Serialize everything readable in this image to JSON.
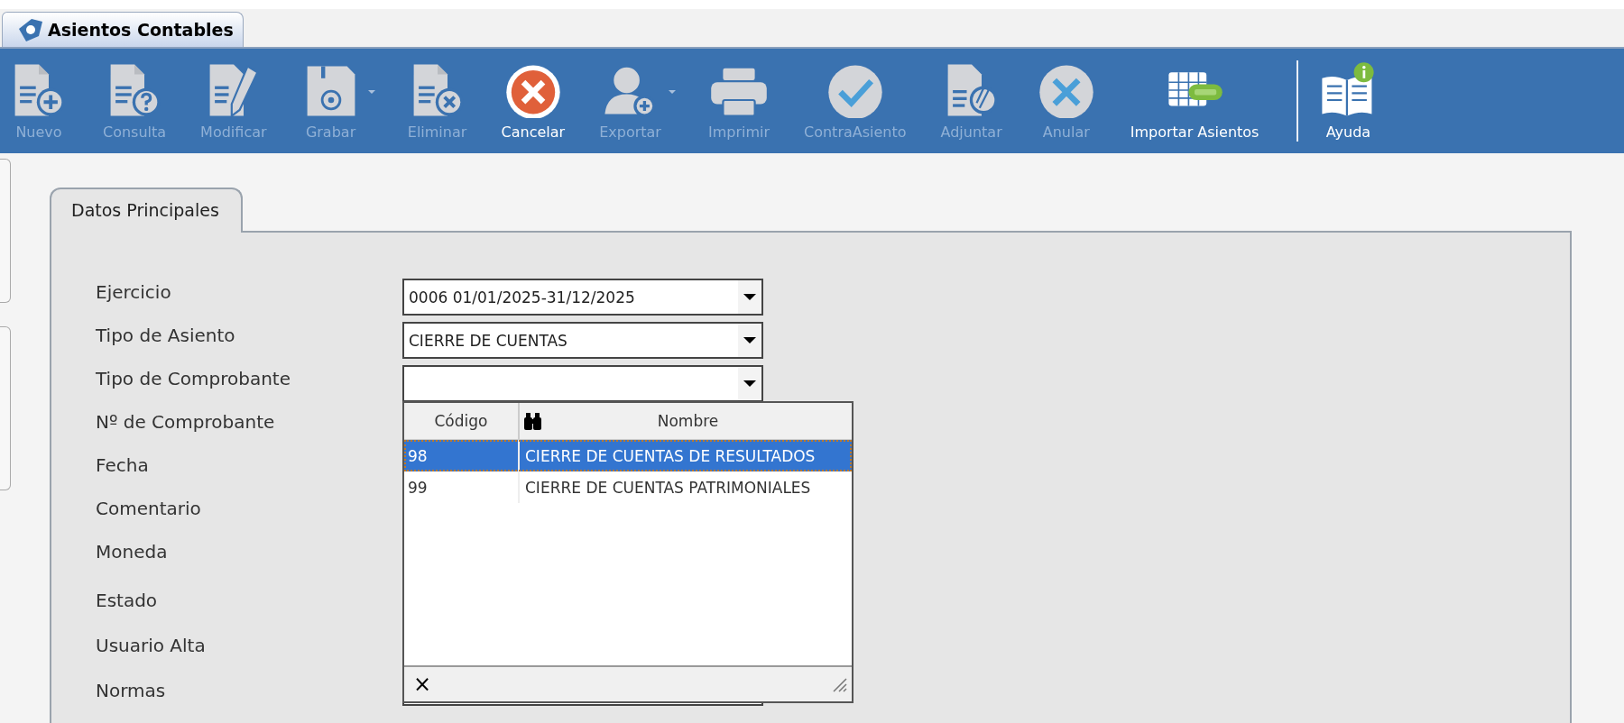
{
  "window_tab": {
    "title": "Asientos Contables"
  },
  "toolbar": [
    {
      "label": "Nuevo",
      "kind": "new",
      "disabled": true
    },
    {
      "label": "Consulta",
      "kind": "query",
      "disabled": true
    },
    {
      "label": "Modificar",
      "kind": "edit",
      "disabled": true
    },
    {
      "label": "Grabar",
      "kind": "save",
      "disabled": true,
      "has_menu": true
    },
    {
      "label": "Eliminar",
      "kind": "delete",
      "disabled": true
    },
    {
      "label": "Cancelar",
      "kind": "cancel",
      "disabled": false
    },
    {
      "label": "Exportar",
      "kind": "export",
      "disabled": true,
      "has_menu": true
    },
    {
      "label": "Imprimir",
      "kind": "print",
      "disabled": true
    },
    {
      "label": "ContraAsiento",
      "kind": "check",
      "disabled": true
    },
    {
      "label": "Adjuntar",
      "kind": "attach",
      "disabled": true
    },
    {
      "label": "Anular",
      "kind": "void",
      "disabled": true
    },
    {
      "label": "Importar Asientos",
      "kind": "excel",
      "disabled": false
    },
    {
      "label": "Ayuda",
      "kind": "help",
      "disabled": false,
      "separator_before": true
    }
  ],
  "form_tabs": [
    {
      "label": "Datos Principales",
      "selected": true
    }
  ],
  "form": {
    "labels": [
      "Ejercicio",
      "Tipo de Asiento",
      "Tipo de Comprobante",
      "Nº de Comprobante",
      "Fecha",
      "Comentario",
      "Moneda",
      "Estado",
      "Usuario Alta",
      "Normas"
    ],
    "combos": [
      {
        "kind": "combo",
        "value": "0006 01/01/2025-31/12/2025"
      },
      {
        "kind": "combo",
        "value": "CIERRE DE CUENTAS"
      },
      {
        "kind": "combo"
      }
    ]
  },
  "dropdown": {
    "columns": [
      "Código",
      "Nombre"
    ],
    "rows": [
      {
        "code": "98",
        "name": "CIERRE DE CUENTAS DE RESULTADOS",
        "selected": true
      },
      {
        "code": "99",
        "name": "CIERRE DE CUENTAS PATRIMONIALES",
        "selected": false
      }
    ],
    "close_label": "×"
  }
}
